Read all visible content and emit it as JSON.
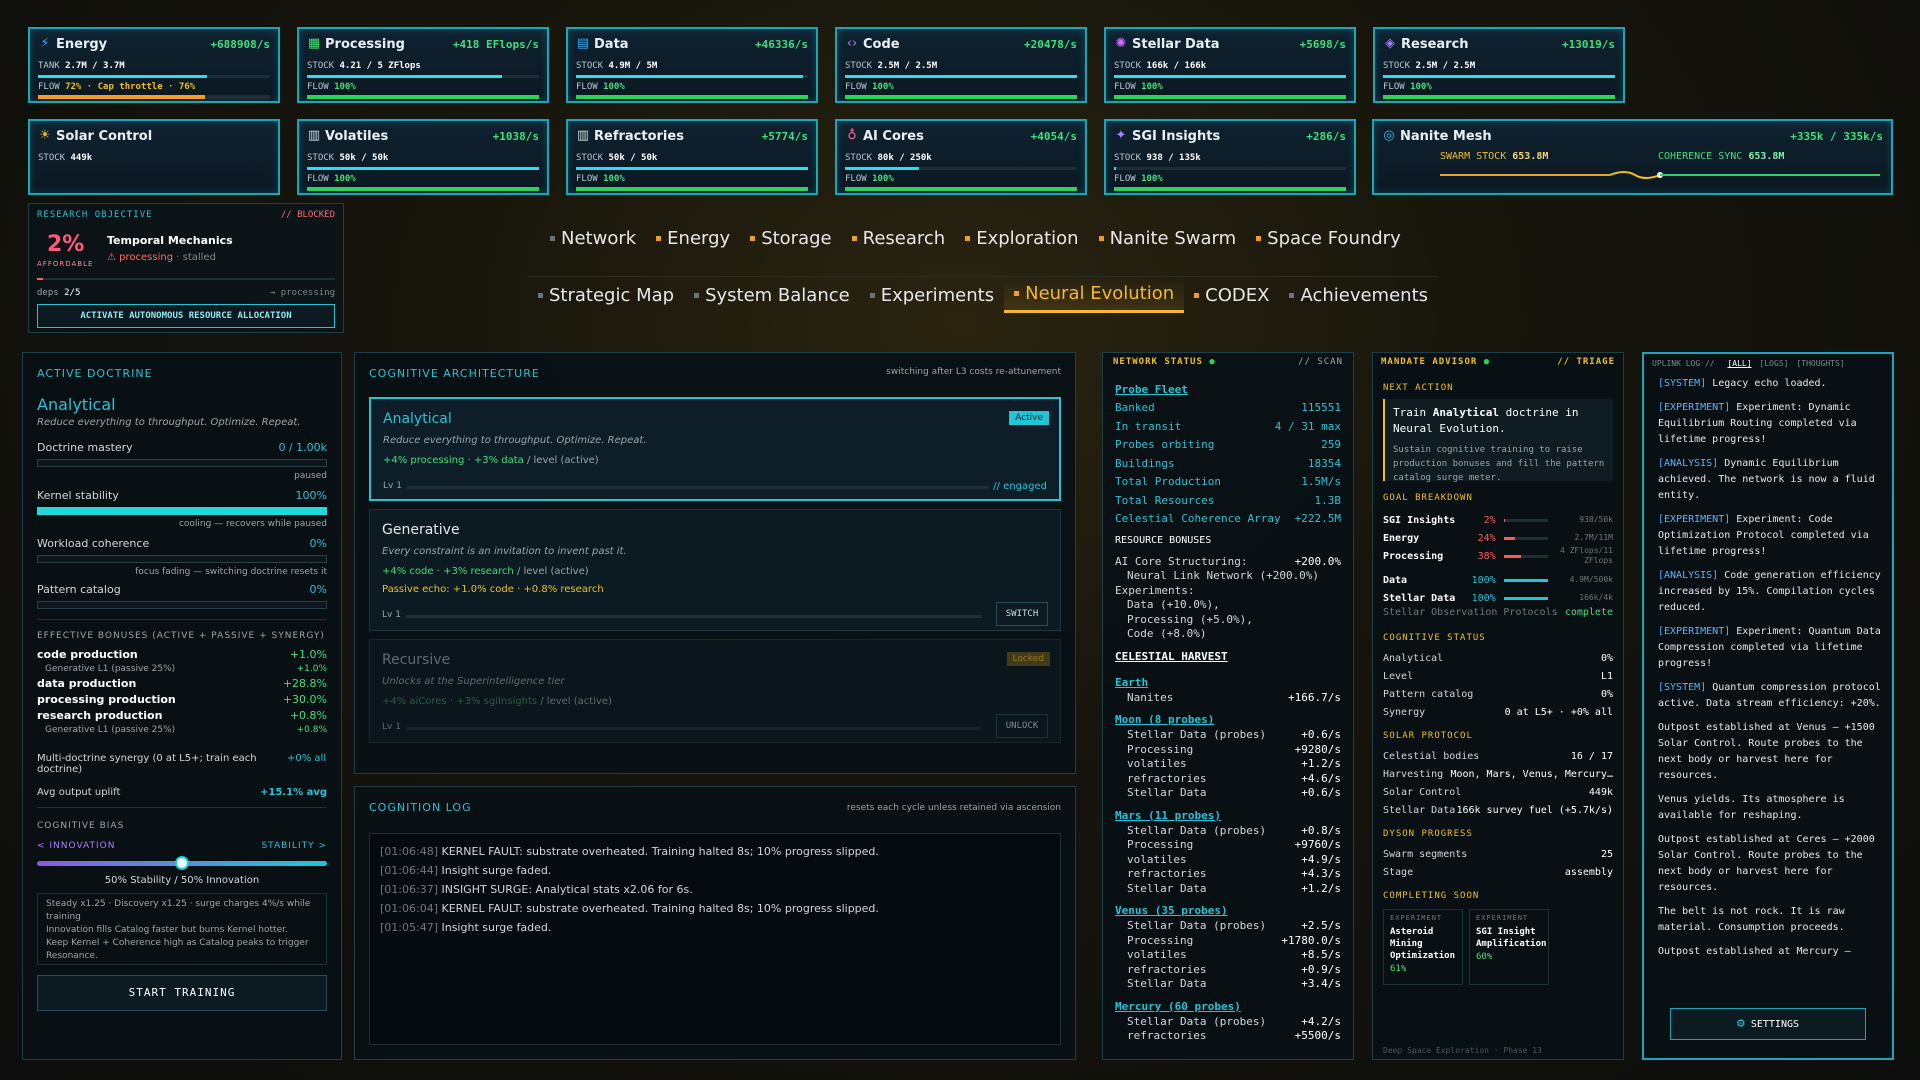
{
  "resources_row1": [
    {
      "name": "Energy",
      "icon": "⚡",
      "icon_color": "#2fa8ff",
      "rate": "+688908/s",
      "stock_label": "TANK",
      "stock": "2.7M / 3.7M",
      "stock_fill": 0.73,
      "flow_label": "FLOW",
      "flow": "72% · Cap throttle · 76%",
      "flow_fill": 0.72,
      "flow_color": "#f0a020"
    },
    {
      "name": "Processing",
      "icon": "▦",
      "icon_color": "#3fe07a",
      "rate": "+418 EFlops/s",
      "stock_label": "STOCK",
      "stock": "4.21 / 5 ZFlops",
      "stock_fill": 0.84,
      "flow_label": "FLOW",
      "flow": "100%",
      "flow_fill": 1,
      "flow_color": "#2fd15e"
    },
    {
      "name": "Data",
      "icon": "▤",
      "icon_color": "#2fa8ff",
      "rate": "+46336/s",
      "stock_label": "STOCK",
      "stock": "4.9M / 5M",
      "stock_fill": 0.98,
      "flow_label": "FLOW",
      "flow": "100%",
      "flow_fill": 1,
      "flow_color": "#2fd15e"
    },
    {
      "name": "Code",
      "icon": "‹›",
      "icon_color": "#b07cff",
      "rate": "+20478/s",
      "stock_label": "STOCK",
      "stock": "2.5M / 2.5M",
      "stock_fill": 1,
      "flow_label": "FLOW",
      "flow": "100%",
      "flow_fill": 1,
      "flow_color": "#2fd15e"
    },
    {
      "name": "Stellar Data",
      "icon": "✺",
      "icon_color": "#d06cff",
      "rate": "+5698/s",
      "stock_label": "STOCK",
      "stock": "166k / 166k",
      "stock_fill": 1,
      "flow_label": "FLOW",
      "flow": "100%",
      "flow_fill": 1,
      "flow_color": "#2fd15e"
    },
    {
      "name": "Research",
      "icon": "◈",
      "icon_color": "#a07cff",
      "rate": "+13019/s",
      "stock_label": "STOCK",
      "stock": "2.5M / 2.5M",
      "stock_fill": 1,
      "flow_label": "FLOW",
      "flow": "100%",
      "flow_fill": 1,
      "flow_color": "#2fd15e"
    }
  ],
  "resources_row2": [
    {
      "name": "Solar Control",
      "icon": "☀",
      "icon_color": "#f0c020",
      "rate": "",
      "stock_label": "STOCK",
      "stock": "449k",
      "stock_fill": 0,
      "flow_label": "",
      "flow": "",
      "flow_fill": 0,
      "flow_color": "#2fd15e"
    },
    {
      "name": "Volatiles",
      "icon": "▥",
      "icon_color": "#cfd8dc",
      "rate": "+1038/s",
      "stock_label": "STOCK",
      "stock": "50k / 50k",
      "stock_fill": 1,
      "flow_label": "FLOW",
      "flow": "100%",
      "flow_fill": 1,
      "flow_color": "#2fd15e"
    },
    {
      "name": "Refractories",
      "icon": "▥",
      "icon_color": "#cfd8dc",
      "rate": "+5774/s",
      "stock_label": "STOCK",
      "stock": "50k / 50k",
      "stock_fill": 1,
      "flow_label": "FLOW",
      "flow": "100%",
      "flow_fill": 1,
      "flow_color": "#2fd15e"
    },
    {
      "name": "AI Cores",
      "icon": "♁",
      "icon_color": "#ff6aa0",
      "rate": "+4054/s",
      "stock_label": "STOCK",
      "stock": "80k / 250k",
      "stock_fill": 0.32,
      "flow_label": "FLOW",
      "flow": "100%",
      "flow_fill": 1,
      "flow_color": "#2fd15e"
    },
    {
      "name": "SGI Insights",
      "icon": "✦",
      "icon_color": "#b07cff",
      "rate": "+286/s",
      "stock_label": "STOCK",
      "stock": "938 / 135k",
      "stock_fill": 0.01,
      "flow_label": "FLOW",
      "flow": "100%",
      "flow_fill": 1,
      "flow_color": "#2fd15e"
    }
  ],
  "nanite": {
    "name": "Nanite Mesh",
    "rate": "+335k / 335k/s",
    "swarm_label": "SWARM STOCK",
    "swarm_value": "653.8M",
    "sync_label": "COHERENCE SYNC",
    "sync_value": "653.8M"
  },
  "objective": {
    "header": "RESEARCH OBJECTIVE",
    "status": "// BLOCKED",
    "percent": "2%",
    "percent_label": "AFFORDABLE",
    "title": "Temporal Mechanics",
    "warn": "processing",
    "stalled": "· stalled",
    "deps": "deps",
    "deps_count": "2/5",
    "deps_right": "→ processing",
    "button": "ACTIVATE AUTONOMOUS RESOURCE ALLOCATION"
  },
  "nav_row1": [
    {
      "label": "Network",
      "dot": "grey"
    },
    {
      "label": "Energy",
      "dot": "orange"
    },
    {
      "label": "Storage",
      "dot": "orange"
    },
    {
      "label": "Research",
      "dot": "orange"
    },
    {
      "label": "Exploration",
      "dot": "orange"
    },
    {
      "label": "Nanite Swarm",
      "dot": "orange"
    },
    {
      "label": "Space Foundry",
      "dot": "orange"
    }
  ],
  "nav_row2": [
    {
      "label": "Strategic Map",
      "dot": "grey"
    },
    {
      "label": "System Balance",
      "dot": "grey"
    },
    {
      "label": "Experiments",
      "dot": "grey"
    },
    {
      "label": "Neural Evolution",
      "dot": "orange",
      "active": true
    },
    {
      "label": "CODEX",
      "dot": "orange"
    },
    {
      "label": "Achievements",
      "dot": "grey"
    }
  ],
  "doctrine": {
    "header": "ACTIVE DOCTRINE",
    "name": "Analytical",
    "tagline": "Reduce everything to throughput. Optimize. Repeat.",
    "mastery_label": "Doctrine mastery",
    "mastery_value": "0 / 1.00k",
    "mastery_note": "paused",
    "kernel_label": "Kernel stability",
    "kernel_value": "100%",
    "kernel_note": "cooling — recovers while paused",
    "coherence_label": "Workload coherence",
    "coherence_value": "0%",
    "coherence_note": "focus fading — switching doctrine resets it",
    "catalog_label": "Pattern catalog",
    "catalog_value": "0%",
    "bonus_header": "EFFECTIVE BONUSES (ACTIVE + PASSIVE + SYNERGY)",
    "bonuses": [
      {
        "label": "code production",
        "value": "+1.0%",
        "sub": "Generative L1 (passive 25%)",
        "sub_value": "+1.0%"
      },
      {
        "label": "data production",
        "value": "+28.8%"
      },
      {
        "label": "processing production",
        "value": "+30.0%"
      },
      {
        "label": "research production",
        "value": "+0.8%",
        "sub": "Generative L1 (passive 25%)",
        "sub_value": "+0.8%"
      }
    ],
    "synergy_label": "Multi-doctrine synergy (0 at L5+; train each doctrine)",
    "synergy_value": "+0% all",
    "uplift_label": "Avg output uplift",
    "uplift_value": "+15.1% avg",
    "bias_header": "COGNITIVE BIAS",
    "bias_left": "< INNOVATION",
    "bias_right": "STABILITY >",
    "bias_level": 0.5,
    "bias_value": "50% Stability / 50% Innovation",
    "bias_notes": [
      "Steady x1.25 · Discovery x1.25 · surge charges 4%/s while training",
      "Innovation fills Catalog faster but burns Kernel hotter.",
      "Keep Kernel + Coherence high as Catalog peaks to trigger Resonance."
    ],
    "train_button": "START TRAINING"
  },
  "architecture": {
    "header": "COGNITIVE ARCHITECTURE",
    "header_note": "switching after L3 costs re-attunement",
    "cards": [
      {
        "name": "Analytical",
        "tagline": "Reduce everything to throughput. Optimize. Repeat.",
        "bonus": "+4% processing · +3% data",
        "bonus_suffix": "/ level (active)",
        "level": "Lv 1",
        "tag": "Active",
        "right": "// engaged"
      },
      {
        "name": "Generative",
        "tagline": "Every constraint is an invitation to invent past it.",
        "bonus": "+4% code · +3% research",
        "bonus_suffix": "/ level (active)",
        "passive": "Passive echo: +1.0% code · +0.8% research",
        "level": "Lv 1",
        "button": "SWITCH"
      },
      {
        "name": "Recursive",
        "tagline": "Unlocks at the Superintelligence tier",
        "bonus": "+4% aiCores · +3% sgiInsights",
        "bonus_suffix": "/ level (active)",
        "level": "Lv 1",
        "tag": "Locked",
        "button": "UNLOCK"
      }
    ]
  },
  "cognition_log": {
    "header": "COGNITION LOG",
    "note": "resets each cycle unless retained via ascension",
    "entries": [
      {
        "time": "[01:06:48]",
        "text": "KERNEL FAULT: substrate overheated. Training halted 8s; 10% progress slipped."
      },
      {
        "time": "[01:06:44]",
        "text": "Insight surge faded."
      },
      {
        "time": "[01:06:37]",
        "text": "INSIGHT SURGE: Analytical stats x2.06 for 6s."
      },
      {
        "time": "[01:06:04]",
        "text": "KERNEL FAULT: substrate overheated. Training halted 8s; 10% progress slipped."
      },
      {
        "time": "[01:05:47]",
        "text": "Insight surge faded."
      }
    ]
  },
  "network": {
    "header": "NETWORK STATUS",
    "tag": "// SCAN",
    "probe_fleet": "Probe Fleet",
    "stats": [
      {
        "label": "Banked",
        "value": "115551"
      },
      {
        "label": "In transit",
        "value": "4 / 31 max"
      },
      {
        "label": "Probes orbiting",
        "value": "259"
      },
      {
        "label": "Buildings",
        "value": "18354"
      },
      {
        "label": "Total Production",
        "value": "1.5M/s"
      },
      {
        "label": "Total Resources",
        "value": "1.3B"
      },
      {
        "label": "Celestial Coherence Array",
        "value": "+222.5M"
      }
    ],
    "bonus_header": "RESOURCE BONUSES",
    "bonus_lines": [
      "AI Core Structuring:",
      "Neural Link Network (+200.0%)",
      "Experiments:",
      "Data (+10.0%),",
      "Processing (+5.0%),",
      "Code (+8.0%)"
    ],
    "bonus_first_value": "+200.0%",
    "harvest_header": "CELESTIAL HARVEST",
    "bodies": [
      {
        "name": "Earth",
        "lines": [
          {
            "label": "Nanites",
            "value": "+166.7/s"
          }
        ]
      },
      {
        "name": "Moon (8 probes)",
        "lines": [
          {
            "label": "Stellar Data (probes)",
            "value": "+0.6/s"
          },
          {
            "label": "Processing",
            "value": "+9280/s"
          },
          {
            "label": "volatiles",
            "value": "+1.2/s"
          },
          {
            "label": "refractories",
            "value": "+4.6/s"
          },
          {
            "label": "Stellar Data",
            "value": "+0.6/s"
          }
        ]
      },
      {
        "name": "Mars (11 probes)",
        "lines": [
          {
            "label": "Stellar Data (probes)",
            "value": "+0.8/s"
          },
          {
            "label": "Processing",
            "value": "+9760/s"
          },
          {
            "label": "volatiles",
            "value": "+4.9/s"
          },
          {
            "label": "refractories",
            "value": "+4.3/s"
          },
          {
            "label": "Stellar Data",
            "value": "+1.2/s"
          }
        ]
      },
      {
        "name": "Venus (35 probes)",
        "lines": [
          {
            "label": "Stellar Data (probes)",
            "value": "+2.5/s"
          },
          {
            "label": "Processing",
            "value": "+1780.0/s"
          },
          {
            "label": "volatiles",
            "value": "+8.5/s"
          },
          {
            "label": "refractories",
            "value": "+0.9/s"
          },
          {
            "label": "Stellar Data",
            "value": "+3.4/s"
          }
        ]
      },
      {
        "name": "Mercury (60 probes)",
        "lines": [
          {
            "label": "Stellar Data (probes)",
            "value": "+4.2/s"
          },
          {
            "label": "refractories",
            "value": "+5500/s"
          }
        ]
      }
    ]
  },
  "advisor": {
    "header": "MANDATE ADVISOR",
    "tag": "// TRIAGE",
    "next_header": "NEXT ACTION",
    "next_pre": "Train",
    "next_bold": "Analytical",
    "next_post": "doctrine in Neural Evolution.",
    "next_desc": "Sustain cognitive training to raise production bonuses and fill the pattern catalog surge meter.",
    "goal_header": "GOAL BREAKDOWN",
    "goals": [
      {
        "label": "SGI Insights",
        "pct": "2%",
        "fill": 0.02,
        "value": "938/50k",
        "color": "#ff5a5a"
      },
      {
        "label": "Energy",
        "pct": "24%",
        "fill": 0.24,
        "value": "2.7M/11M",
        "color": "#ff5a5a"
      },
      {
        "label": "Processing",
        "pct": "38%",
        "fill": 0.38,
        "value": "4 ZFlops/11 ZFlops",
        "color": "#ff5a5a"
      },
      {
        "label": "Data",
        "pct": "100%",
        "fill": 1,
        "value": "4.9M/500k",
        "color": "#23c4d8"
      },
      {
        "label": "Stellar Data",
        "pct": "100%",
        "fill": 1,
        "value": "166k/4k",
        "color": "#23c4d8"
      }
    ],
    "protocol_label": "Stellar Observation Protocols",
    "protocol_value": "complete",
    "cog_header": "COGNITIVE STATUS",
    "cog": [
      {
        "label": "Analytical",
        "value": "0%"
      },
      {
        "label": "Level",
        "value": "L1"
      },
      {
        "label": "Pattern catalog",
        "value": "0%"
      },
      {
        "label": "Synergy",
        "value": "0 at L5+ · +0% all"
      }
    ],
    "solar_header": "SOLAR PROTOCOL",
    "solar": [
      {
        "label": "Celestial bodies",
        "value": "16 / 17"
      },
      {
        "label": "Harvesting",
        "value": "Moon, Mars, Venus, Mercury…"
      },
      {
        "label": "Solar Control",
        "value": "449k"
      },
      {
        "label": "Stellar Data",
        "value": "166k survey fuel (+5.7k/s)"
      }
    ],
    "dyson_header": "DYSON PROGRESS",
    "dyson": [
      {
        "label": "Swarm segments",
        "value": "25"
      },
      {
        "label": "Stage",
        "value": "assembly"
      }
    ],
    "soon_header": "COMPLETING SOON",
    "soon": [
      {
        "kind": "EXPERIMENT",
        "name": "Asteroid Mining Optimization",
        "pct": "61%"
      },
      {
        "kind": "EXPERIMENT",
        "name": "SGI Insight Amplification",
        "pct": "60%"
      }
    ],
    "footer": "Deep Space Exploration · Phase 13"
  },
  "uplink": {
    "header": "UPLINK LOG //",
    "tabs": [
      "[ALL]",
      "[LOGS]",
      "[THOUGHTS]"
    ],
    "entries": [
      {
        "tag": "[SYSTEM]",
        "text": "Legacy echo loaded."
      },
      {
        "tag": "[EXPERIMENT]",
        "text": "Experiment: Dynamic Equilibrium Routing completed via lifetime progress!"
      },
      {
        "tag": "[ANALYSIS]",
        "text": "Dynamic Equilibrium achieved. The network is now a fluid entity."
      },
      {
        "tag": "[EXPERIMENT]",
        "text": "Experiment: Code Optimization Protocol completed via lifetime progress!"
      },
      {
        "tag": "[ANALYSIS]",
        "text": "Code generation efficiency increased by 15%. Compilation cycles reduced."
      },
      {
        "tag": "[EXPERIMENT]",
        "text": "Experiment: Quantum Data Compression completed via lifetime progress!"
      },
      {
        "tag": "[SYSTEM]",
        "text": "Quantum compression protocol active. Data stream efficiency: +20%."
      },
      {
        "tag": "",
        "text": "Outpost established at Venus — +1500 Solar Control. Route probes to the next body or harvest here for resources."
      },
      {
        "tag": "",
        "text": "Venus yields. Its atmosphere is available for reshaping."
      },
      {
        "tag": "",
        "text": "Outpost established at Ceres — +2000 Solar Control. Route probes to the next body or harvest here for resources."
      },
      {
        "tag": "",
        "text": "The belt is not rock. It is raw material. Consumption proceeds."
      },
      {
        "tag": "",
        "text": "Outpost established at Mercury —"
      }
    ],
    "settings": "SETTINGS"
  }
}
